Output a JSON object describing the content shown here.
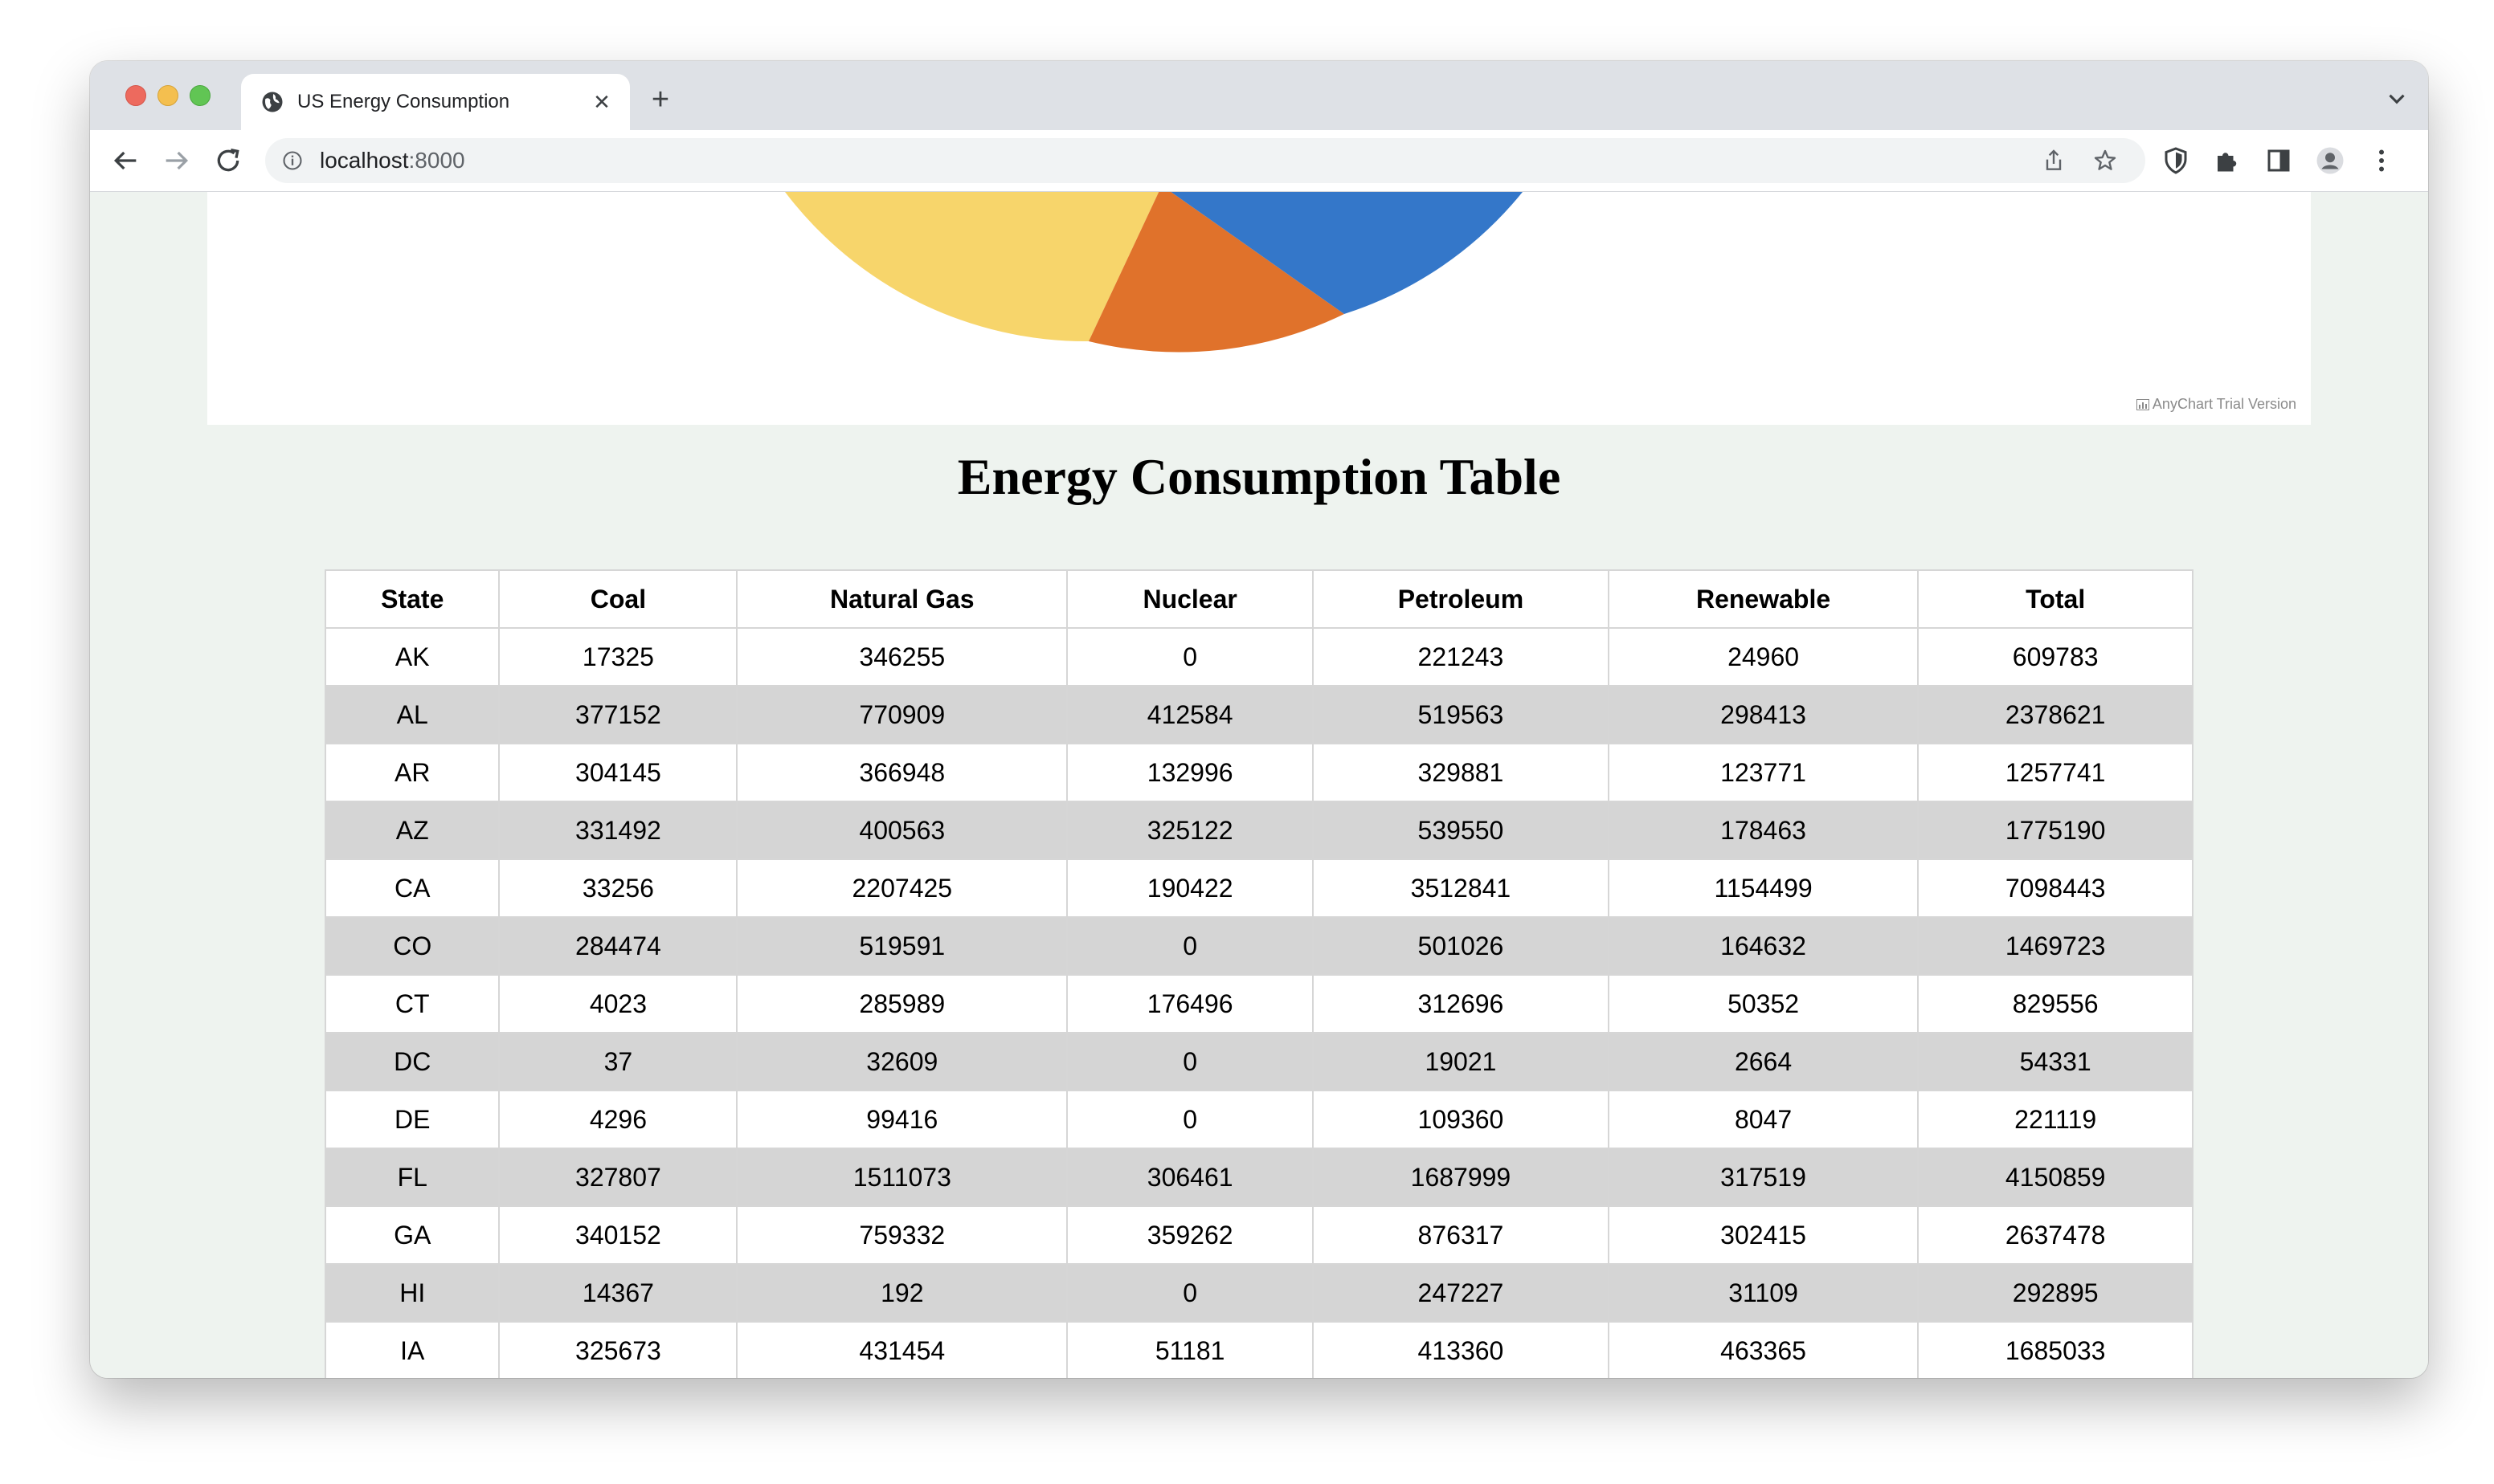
{
  "browser": {
    "tab_title": "US Energy Consumption",
    "url_host": "localhost",
    "url_port": ":8000"
  },
  "chart": {
    "credits": "AnyChart Trial Version",
    "visible_slice_colors": [
      "#f7d56b",
      "#e0722b",
      "#3477c9"
    ]
  },
  "page": {
    "heading": "Energy Consumption Table"
  },
  "table": {
    "headers": [
      "State",
      "Coal",
      "Natural Gas",
      "Nuclear",
      "Petroleum",
      "Renewable",
      "Total"
    ],
    "rows": [
      [
        "AK",
        "17325",
        "346255",
        "0",
        "221243",
        "24960",
        "609783"
      ],
      [
        "AL",
        "377152",
        "770909",
        "412584",
        "519563",
        "298413",
        "2378621"
      ],
      [
        "AR",
        "304145",
        "366948",
        "132996",
        "329881",
        "123771",
        "1257741"
      ],
      [
        "AZ",
        "331492",
        "400563",
        "325122",
        "539550",
        "178463",
        "1775190"
      ],
      [
        "CA",
        "33256",
        "2207425",
        "190422",
        "3512841",
        "1154499",
        "7098443"
      ],
      [
        "CO",
        "284474",
        "519591",
        "0",
        "501026",
        "164632",
        "1469723"
      ],
      [
        "CT",
        "4023",
        "285989",
        "176496",
        "312696",
        "50352",
        "829556"
      ],
      [
        "DC",
        "37",
        "32609",
        "0",
        "19021",
        "2664",
        "54331"
      ],
      [
        "DE",
        "4296",
        "99416",
        "0",
        "109360",
        "8047",
        "221119"
      ],
      [
        "FL",
        "327807",
        "1511073",
        "306461",
        "1687999",
        "317519",
        "4150859"
      ],
      [
        "GA",
        "340152",
        "759332",
        "359262",
        "876317",
        "302415",
        "2637478"
      ],
      [
        "HI",
        "14367",
        "192",
        "0",
        "247227",
        "31109",
        "292895"
      ],
      [
        "IA",
        "325673",
        "431454",
        "51181",
        "413360",
        "463365",
        "1685033"
      ]
    ]
  }
}
